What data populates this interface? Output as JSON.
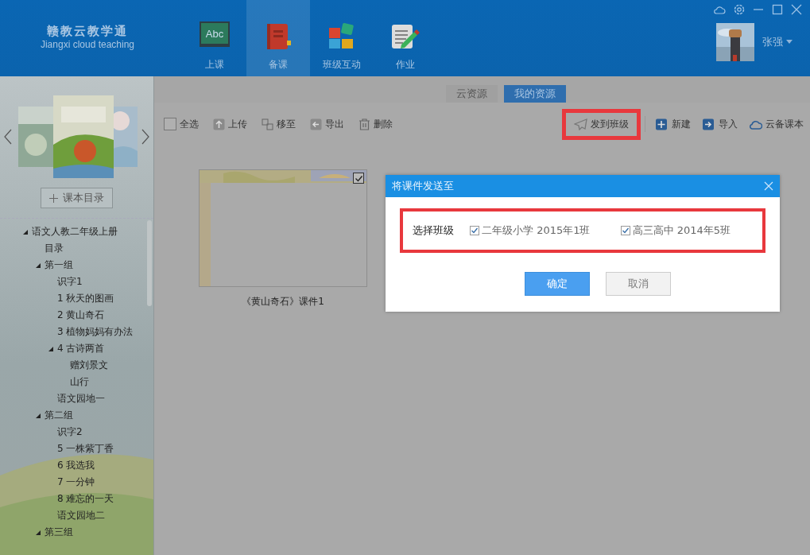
{
  "header": {
    "logo": {
      "title": "赣教云教学通",
      "subtitle": "Jiangxi cloud teaching"
    },
    "nav": [
      {
        "label": "上课",
        "kind": "board",
        "icon_text": "Abc",
        "selected": false
      },
      {
        "label": "备课",
        "kind": "book",
        "selected": true
      },
      {
        "label": "班级互动",
        "kind": "blocks",
        "selected": false
      },
      {
        "label": "作业",
        "kind": "notepad",
        "selected": false
      }
    ],
    "user": {
      "name": "张强"
    }
  },
  "sidebar": {
    "catalog_button": "课本目录",
    "tree": [
      {
        "label": "语文人教二年级上册",
        "expanded": true,
        "children": [
          {
            "label": "目录"
          },
          {
            "label": "第一组",
            "expanded": true,
            "children": [
              {
                "label": "识字1"
              },
              {
                "label": "1 秋天的图画"
              },
              {
                "label": "2 黄山奇石"
              },
              {
                "label": "3 植物妈妈有办法"
              },
              {
                "label": "4 古诗两首",
                "expanded": true,
                "children": [
                  {
                    "label": "赠刘景文"
                  },
                  {
                    "label": "山行"
                  }
                ]
              },
              {
                "label": "语文园地一"
              }
            ]
          },
          {
            "label": "第二组",
            "expanded": true,
            "children": [
              {
                "label": "识字2"
              },
              {
                "label": "5 一株紫丁香"
              },
              {
                "label": "6 我选我"
              },
              {
                "label": "7 一分钟"
              },
              {
                "label": "8 难忘的一天"
              },
              {
                "label": "语文园地二"
              }
            ]
          },
          {
            "label": "第三组",
            "expanded": true
          }
        ]
      }
    ]
  },
  "resource_tabs": [
    {
      "label": "云资源",
      "selected": false
    },
    {
      "label": "我的资源",
      "selected": true
    }
  ],
  "toolbar": {
    "select_all": {
      "label": "全选",
      "checked": false
    },
    "left": [
      {
        "label": "上传",
        "kind": "upload"
      },
      {
        "label": "移至",
        "kind": "move"
      },
      {
        "label": "导出",
        "kind": "export"
      },
      {
        "label": "删除",
        "kind": "delete"
      }
    ],
    "right": [
      {
        "label": "发到班级",
        "kind": "send",
        "highlighted": true
      },
      {
        "label": "新建",
        "kind": "new",
        "highlighted": false
      },
      {
        "label": "导入",
        "kind": "import",
        "highlighted": false
      },
      {
        "label": "云备课本",
        "kind": "cloud",
        "highlighted": false
      }
    ]
  },
  "files": [
    {
      "title": "《黄山奇石》课件1",
      "checked": true
    }
  ],
  "dialog": {
    "title": "将课件发送至",
    "field_label": "选择班级",
    "highlighted": true,
    "options": [
      {
        "label": "二年级小学 2015年1班",
        "checked": true
      },
      {
        "label": "高三高中 2014年5班",
        "checked": true
      }
    ],
    "buttons": [
      {
        "label": "确定",
        "kind": "primary"
      },
      {
        "label": "取消",
        "kind": "secondary"
      }
    ]
  }
}
